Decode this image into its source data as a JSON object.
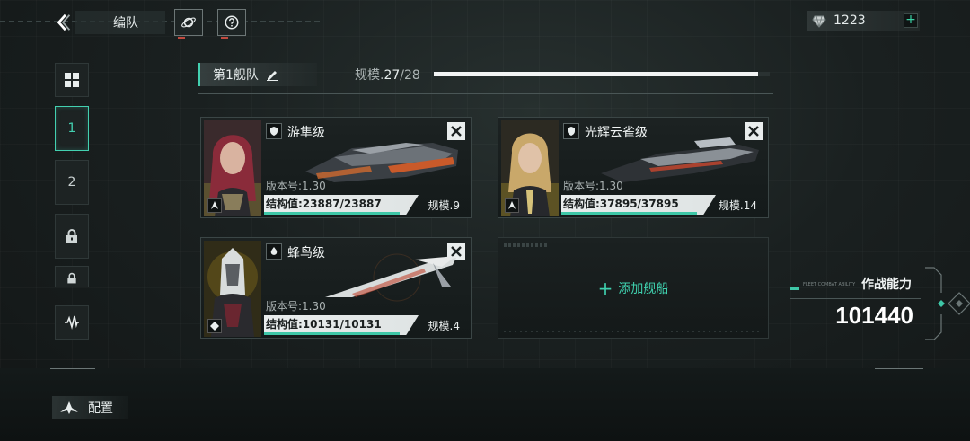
{
  "header": {
    "title": "编队",
    "currency_value": "1223"
  },
  "sidebar": {
    "items": [
      {
        "label": "",
        "icon": "grid-icon"
      },
      {
        "label": "1",
        "active": true
      },
      {
        "label": "2"
      },
      {
        "label": "",
        "icon": "lock-icon"
      },
      {
        "label": "",
        "icon": "lock-icon"
      },
      {
        "label": "",
        "icon": "wave-icon"
      }
    ]
  },
  "fleet": {
    "name": "第1舰队",
    "scale_label": "规模.",
    "scale_current": "27",
    "scale_max": "/28",
    "scale_fraction": 0.964
  },
  "ships": [
    {
      "class_name": "游隼级",
      "version": "版本号:1.30",
      "structure": "结构值:23887/23887",
      "structure_fraction": 1.0,
      "scale": "规模.9"
    },
    {
      "class_name": "光辉云雀级",
      "version": "版本号:1.30",
      "structure": "结构值:37895/37895",
      "structure_fraction": 1.0,
      "scale": "规模.14"
    },
    {
      "class_name": "蜂鸟级",
      "version": "版本号:1.30",
      "structure": "结构值:10131/10131",
      "structure_fraction": 1.0,
      "scale": "规模.4"
    }
  ],
  "add_ship": {
    "label": "添加舰船"
  },
  "combat": {
    "label": "作战能力",
    "sub_label": "FLEET COMBAT ABILITY",
    "value": "101440"
  },
  "config": {
    "label": "配置"
  },
  "colors": {
    "accent": "#43d0b0",
    "structure_bar": "#3ec7a7",
    "bg": "#1a2020"
  }
}
